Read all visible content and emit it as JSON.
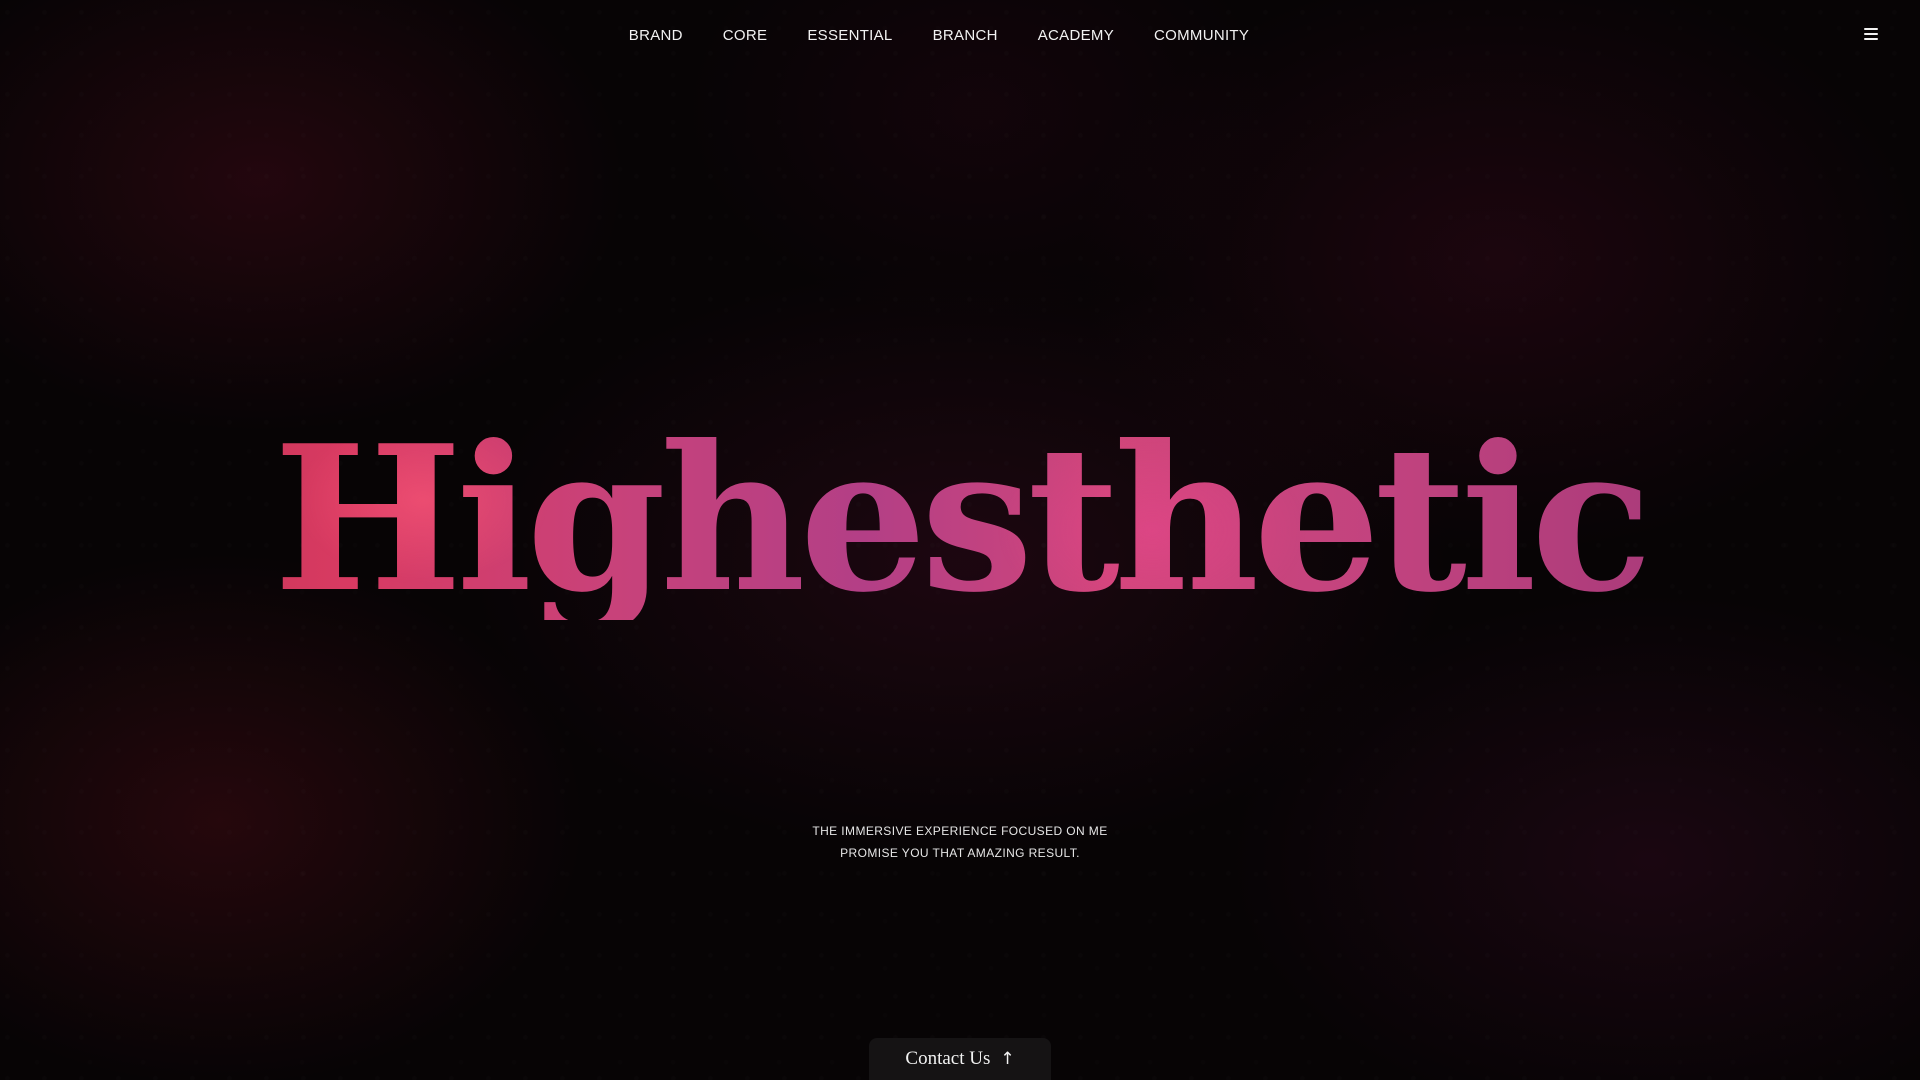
{
  "nav": {
    "items": [
      {
        "label": "BRAND"
      },
      {
        "label": "CORE"
      },
      {
        "label": "ESSENTIAL"
      },
      {
        "label": "BRANCH"
      },
      {
        "label": "ACADEMY"
      },
      {
        "label": "COMMUNITY"
      }
    ],
    "menu_icon": "hamburger-menu-icon"
  },
  "hero": {
    "title": "Highesthetic",
    "tagline_line1": "THE IMMERSIVE EXPERIENCE FOCUSED ON ME",
    "tagline_line2": "PROMISE YOU THAT AMAZING RESULT."
  },
  "contact": {
    "label": "Contact Us",
    "icon": "arrow-up-icon",
    "arrow": "↑"
  },
  "colors": {
    "background": "#070405",
    "title_gradient_start": "#b8324a",
    "title_gradient_mid": "#d83a62",
    "title_gradient_end": "#a83a7a",
    "text": "#f2f2f2",
    "button_bg": "#151314"
  }
}
